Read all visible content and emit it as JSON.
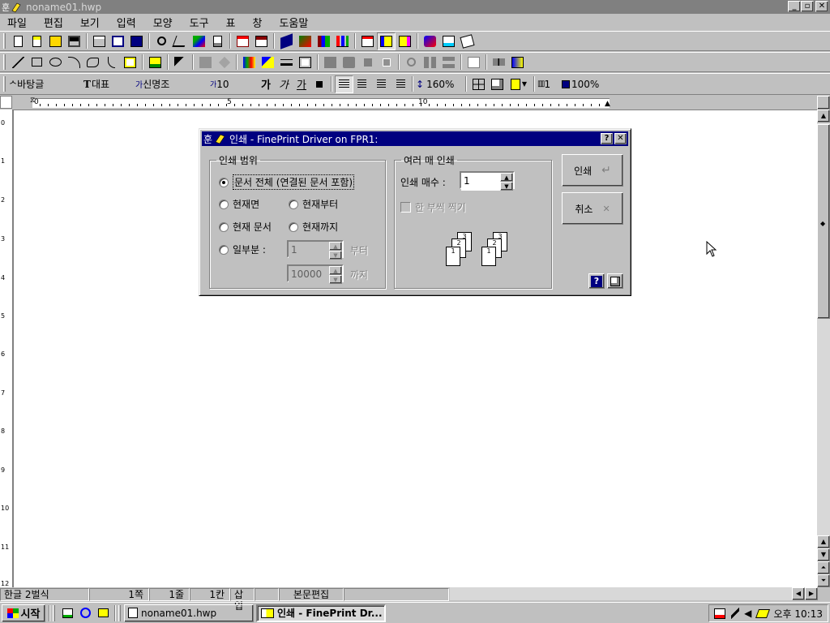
{
  "window": {
    "title": "noname01.hwp",
    "minimize": "_",
    "restore": "▫",
    "close": "✕"
  },
  "menu": [
    "파일",
    "편집",
    "보기",
    "입력",
    "모양",
    "도구",
    "표",
    "창",
    "도움말"
  ],
  "format_bar": {
    "style": "바탕글",
    "char_type": "대표",
    "font": "신명조",
    "size": "10",
    "bold": "가",
    "italic": "가",
    "underline": "가",
    "line_spacing": "160%",
    "columns": "1",
    "zoom": "100%"
  },
  "ruler": {
    "marks": [
      "0",
      "5",
      "10"
    ]
  },
  "vruler": [
    "0",
    "1",
    "2",
    "3",
    "4",
    "5",
    "6",
    "7",
    "8",
    "9",
    "10",
    "11",
    "12"
  ],
  "status": {
    "lang": "한글 2벌식",
    "page": "1쪽",
    "line": "1줄",
    "col": "1칸",
    "mode": "삽입",
    "edit": "본문편집"
  },
  "taskbar": {
    "start": "시작",
    "tasks": [
      "noname01.hwp",
      "인쇄 - FinePrint Dr..."
    ],
    "clock": "오후 10:13"
  },
  "dialog": {
    "title": "인쇄 - FinePrint Driver on FPR1:",
    "help_btn": "?",
    "close_btn": "✕",
    "range_legend": "인쇄 범위",
    "opt_all": "문서 전체 (연결된 문서 포함)",
    "opt_current_page": "현재면",
    "opt_from_current": "현재부터",
    "opt_current_doc": "현재 문서",
    "opt_to_current": "현재까지",
    "opt_partial": "일부분 :",
    "from_value": "1",
    "from_label": "부터",
    "to_value": "10000",
    "to_label": "까지",
    "copies_legend": "여러 매 인쇄",
    "copies_label": "인쇄 매수 :",
    "copies_value": "1",
    "collate_label": "한 부씩 찍기",
    "print_btn": "인쇄",
    "print_btn_icon": "↵",
    "cancel_btn": "취소",
    "cancel_btn_icon": "✕",
    "page_labels": [
      "3",
      "2",
      "1"
    ]
  }
}
